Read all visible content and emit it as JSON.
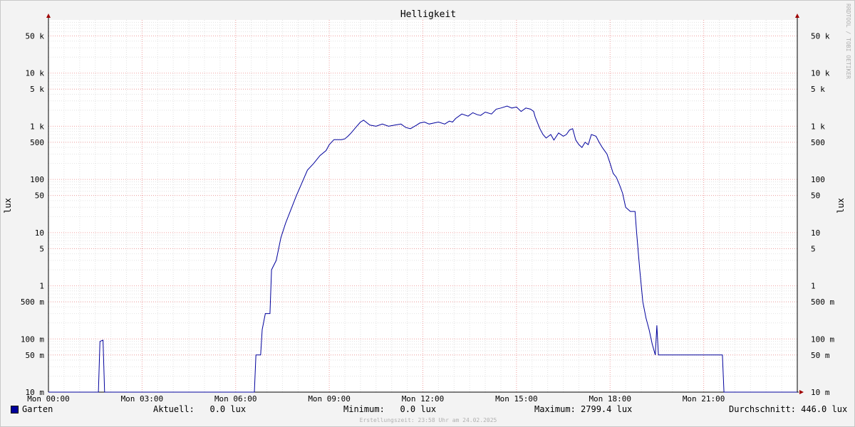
{
  "chart_data": {
    "type": "line",
    "title": "Helligkeit",
    "ylabel": "lux",
    "yscale": "log",
    "ylim": [
      0.01,
      100000
    ],
    "y_ticks": [
      {
        "value": 50000,
        "label": "50 k"
      },
      {
        "value": 10000,
        "label": "10 k"
      },
      {
        "value": 5000,
        "label": "5 k"
      },
      {
        "value": 1000,
        "label": "1 k"
      },
      {
        "value": 500,
        "label": "500"
      },
      {
        "value": 100,
        "label": "100"
      },
      {
        "value": 50,
        "label": "50"
      },
      {
        "value": 10,
        "label": "10"
      },
      {
        "value": 5,
        "label": "5"
      },
      {
        "value": 1,
        "label": "1"
      },
      {
        "value": 0.5,
        "label": "500 m"
      },
      {
        "value": 0.1,
        "label": "100 m"
      },
      {
        "value": 0.05,
        "label": "50 m"
      },
      {
        "value": 0.01,
        "label": "10 m"
      }
    ],
    "x_ticks": [
      {
        "hour": 0,
        "label": "Mon 00:00"
      },
      {
        "hour": 3,
        "label": "Mon 03:00"
      },
      {
        "hour": 6,
        "label": "Mon 06:00"
      },
      {
        "hour": 9,
        "label": "Mon 09:00"
      },
      {
        "hour": 12,
        "label": "Mon 12:00"
      },
      {
        "hour": 15,
        "label": "Mon 15:00"
      },
      {
        "hour": 18,
        "label": "Mon 18:00"
      },
      {
        "hour": 21,
        "label": "Mon 21:00"
      }
    ],
    "xlim": [
      0,
      24
    ],
    "grid": true,
    "series": [
      {
        "name": "Garten",
        "color": "#00009c",
        "points": [
          [
            0.0,
            0.01
          ],
          [
            1.6,
            0.01
          ],
          [
            1.65,
            0.09
          ],
          [
            1.75,
            0.095
          ],
          [
            1.8,
            0.01
          ],
          [
            6.6,
            0.01
          ],
          [
            6.65,
            0.05
          ],
          [
            6.8,
            0.05
          ],
          [
            6.85,
            0.15
          ],
          [
            6.95,
            0.3
          ],
          [
            7.1,
            0.3
          ],
          [
            7.15,
            2
          ],
          [
            7.3,
            3
          ],
          [
            7.45,
            8
          ],
          [
            7.6,
            15
          ],
          [
            7.8,
            30
          ],
          [
            7.95,
            50
          ],
          [
            8.1,
            80
          ],
          [
            8.3,
            150
          ],
          [
            8.5,
            200
          ],
          [
            8.7,
            280
          ],
          [
            8.9,
            350
          ],
          [
            9.0,
            450
          ],
          [
            9.15,
            560
          ],
          [
            9.4,
            560
          ],
          [
            9.5,
            580
          ],
          [
            9.6,
            650
          ],
          [
            9.7,
            750
          ],
          [
            9.85,
            950
          ],
          [
            10.0,
            1200
          ],
          [
            10.1,
            1300
          ],
          [
            10.3,
            1050
          ],
          [
            10.5,
            1000
          ],
          [
            10.7,
            1100
          ],
          [
            10.9,
            1000
          ],
          [
            11.1,
            1050
          ],
          [
            11.3,
            1100
          ],
          [
            11.45,
            950
          ],
          [
            11.6,
            900
          ],
          [
            11.8,
            1050
          ],
          [
            11.9,
            1150
          ],
          [
            12.05,
            1200
          ],
          [
            12.2,
            1100
          ],
          [
            12.35,
            1150
          ],
          [
            12.5,
            1200
          ],
          [
            12.7,
            1100
          ],
          [
            12.85,
            1250
          ],
          [
            12.95,
            1200
          ],
          [
            13.05,
            1400
          ],
          [
            13.25,
            1700
          ],
          [
            13.45,
            1550
          ],
          [
            13.6,
            1800
          ],
          [
            13.75,
            1650
          ],
          [
            13.85,
            1600
          ],
          [
            14.0,
            1850
          ],
          [
            14.2,
            1700
          ],
          [
            14.35,
            2100
          ],
          [
            14.5,
            2200
          ],
          [
            14.7,
            2400
          ],
          [
            14.85,
            2200
          ],
          [
            15.0,
            2300
          ],
          [
            15.15,
            1900
          ],
          [
            15.3,
            2200
          ],
          [
            15.45,
            2100
          ],
          [
            15.55,
            1900
          ],
          [
            15.6,
            1500
          ],
          [
            15.75,
            900
          ],
          [
            15.85,
            700
          ],
          [
            15.95,
            600
          ],
          [
            16.1,
            700
          ],
          [
            16.2,
            550
          ],
          [
            16.35,
            750
          ],
          [
            16.5,
            650
          ],
          [
            16.6,
            700
          ],
          [
            16.7,
            850
          ],
          [
            16.8,
            900
          ],
          [
            16.9,
            550
          ],
          [
            17.0,
            450
          ],
          [
            17.1,
            400
          ],
          [
            17.2,
            500
          ],
          [
            17.3,
            450
          ],
          [
            17.4,
            700
          ],
          [
            17.55,
            650
          ],
          [
            17.65,
            500
          ],
          [
            17.75,
            400
          ],
          [
            17.9,
            300
          ],
          [
            18.0,
            200
          ],
          [
            18.1,
            130
          ],
          [
            18.2,
            110
          ],
          [
            18.3,
            80
          ],
          [
            18.4,
            55
          ],
          [
            18.5,
            30
          ],
          [
            18.65,
            25
          ],
          [
            18.8,
            25
          ],
          [
            18.85,
            10
          ],
          [
            18.95,
            2
          ],
          [
            19.05,
            0.5
          ],
          [
            19.15,
            0.25
          ],
          [
            19.25,
            0.15
          ],
          [
            19.35,
            0.08
          ],
          [
            19.45,
            0.05
          ],
          [
            19.5,
            0.18
          ],
          [
            19.55,
            0.05
          ],
          [
            21.6,
            0.05
          ],
          [
            21.65,
            0.01
          ],
          [
            24.0,
            0.01
          ]
        ]
      }
    ]
  },
  "legend": {
    "series_name": "Garten",
    "aktuell": "Aktuell:   0.0 lux",
    "minimum": "Minimum:   0.0 lux",
    "maximum": "Maximum: 2799.4 lux",
    "durchschnitt": "Durchschnitt: 446.0 lux"
  },
  "footer": "Erstellungszeit: 23:58 Uhr am 24.02.2025",
  "side_text": "RRDTOOL / TOBI OETIKER"
}
